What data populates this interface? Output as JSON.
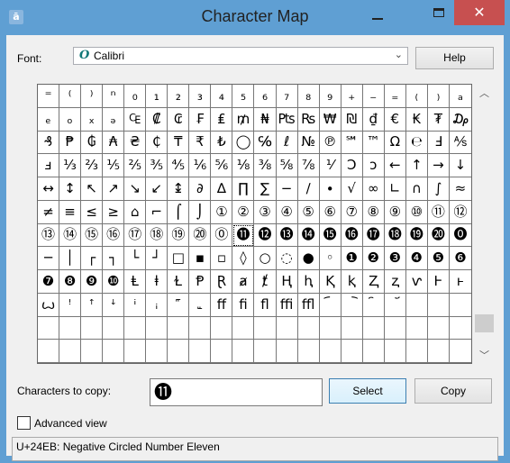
{
  "window": {
    "title": "Character Map",
    "icon": "charmap-app-icon",
    "close_glyph": "✕",
    "colors": {
      "frame": "#5f9fd3",
      "close": "#c75050"
    }
  },
  "font": {
    "label": "Font:",
    "value": "Calibri",
    "font_type_glyph": "O",
    "help_label": "Help"
  },
  "grid": {
    "rows": [
      [
        "⁼",
        "⁽",
        "⁾",
        "ⁿ",
        "₀",
        "₁",
        "₂",
        "₃",
        "₄",
        "₅",
        "₆",
        "₇",
        "₈",
        "₉",
        "₊",
        "₋",
        "₌",
        "₍",
        "₎",
        "ₐ"
      ],
      [
        "ₑ",
        "ₒ",
        "ₓ",
        "ₔ",
        "₠",
        "₡",
        "₢",
        "₣",
        "₤",
        "₥",
        "₦",
        "₧",
        "₨",
        "₩",
        "₪",
        "₫",
        "€",
        "₭",
        "₮",
        "₯"
      ],
      [
        "₰",
        "₱",
        "₲",
        "₳",
        "₴",
        "₵",
        "₸",
        "₹",
        "₺",
        "◯",
        "℅",
        "ℓ",
        "№",
        "℗",
        "℠",
        "™",
        "Ω",
        "℮",
        "Ⅎ",
        "⅍"
      ],
      [
        "ⅎ",
        "⅓",
        "⅔",
        "⅕",
        "⅖",
        "⅗",
        "⅘",
        "⅙",
        "⅚",
        "⅛",
        "⅜",
        "⅝",
        "⅞",
        "⅟",
        "Ↄ",
        "ↄ",
        "←",
        "↑",
        "→",
        "↓"
      ],
      [
        "↔",
        "↕",
        "↖",
        "↗",
        "↘",
        "↙",
        "↨",
        "∂",
        "∆",
        "∏",
        "∑",
        "−",
        "∕",
        "∙",
        "√",
        "∞",
        "∟",
        "∩",
        "∫",
        "≈"
      ],
      [
        "≠",
        "≡",
        "≤",
        "≥",
        "⌂",
        "⌐",
        "⌠",
        "⌡",
        "①",
        "②",
        "③",
        "④",
        "⑤",
        "⑥",
        "⑦",
        "⑧",
        "⑨",
        "⑩",
        "⑪",
        "⑫"
      ],
      [
        "⑬",
        "⑭",
        "⑮",
        "⑯",
        "⑰",
        "⑱",
        "⑲",
        "⑳",
        "⓪",
        "⓫",
        "⓬",
        "⓭",
        "⓮",
        "⓯",
        "⓰",
        "⓱",
        "⓲",
        "⓳",
        "⓴",
        "⓿"
      ],
      [
        "─",
        "│",
        "┌",
        "┐",
        "└",
        "┘",
        "□",
        "▪",
        "▫",
        "◊",
        "○",
        "◌",
        "●",
        "◦",
        "❶",
        "❷",
        "❸",
        "❹",
        "❺",
        "❻"
      ],
      [
        "❼",
        "❽",
        "❾",
        "❿",
        "Ⱡ",
        "ⱡ",
        "Ɫ",
        "Ᵽ",
        "Ɽ",
        "ⱥ",
        "ⱦ",
        "Ⱨ",
        "ⱨ",
        "Ⱪ",
        "ⱪ",
        "Ⱬ",
        "ⱬ",
        "ⱱ",
        "Ⱶ",
        "ⱶ"
      ],
      [
        "ꙍ",
        "ꜝ",
        "ꜛ",
        "ꜜ",
        "ꜞ",
        "ꜟ",
        "꜠",
        "꜡",
        "ﬀ",
        "ﬁ",
        "ﬂ",
        "ﬃ",
        "ﬄ",
        "︠",
        "︡",
        "︢",
        "︣",
        "",
        "",
        ""
      ]
    ],
    "selected": {
      "row": 6,
      "col": 9
    }
  },
  "scrollbar": {
    "up_glyph": "︿",
    "down_glyph": "﹀",
    "position_fraction": 0.92
  },
  "copy": {
    "label": "Characters to copy:",
    "value": "⓫",
    "select_label": "Select",
    "copy_label": "Copy"
  },
  "advanced": {
    "label": "Advanced view",
    "checked": false
  },
  "status": {
    "text": "U+24EB: Negative Circled Number Eleven"
  }
}
